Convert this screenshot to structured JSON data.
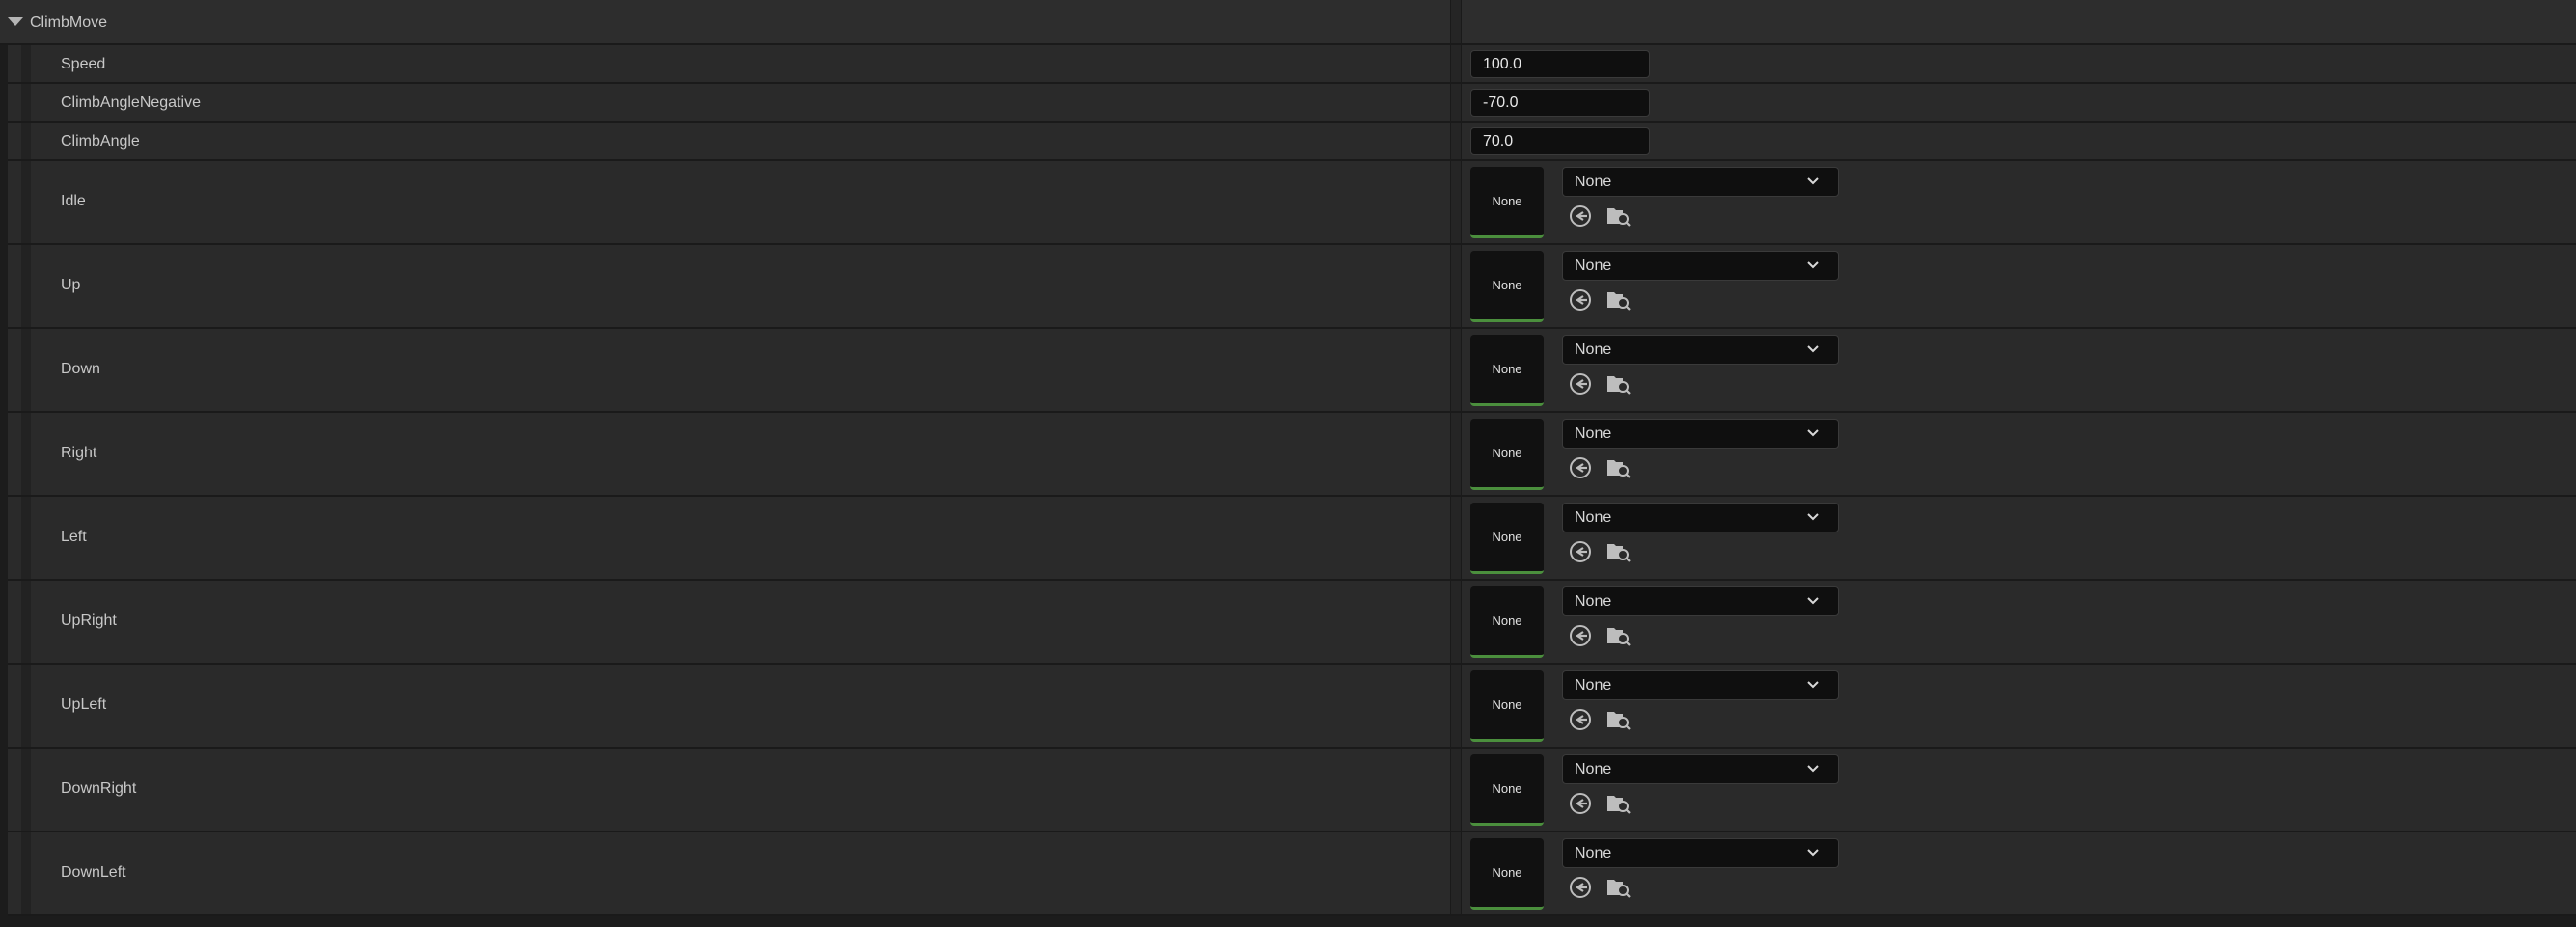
{
  "section": {
    "title": "ClimbMove",
    "icon": "caret-down-icon"
  },
  "numeric_properties": [
    {
      "label": "Speed",
      "value": "100.0"
    },
    {
      "label": "ClimbAngleNegative",
      "value": "-70.0"
    },
    {
      "label": "ClimbAngle",
      "value": "70.0"
    }
  ],
  "asset_properties": [
    {
      "label": "Idle",
      "thumb": "None",
      "selected": "None"
    },
    {
      "label": "Up",
      "thumb": "None",
      "selected": "None"
    },
    {
      "label": "Down",
      "thumb": "None",
      "selected": "None"
    },
    {
      "label": "Right",
      "thumb": "None",
      "selected": "None"
    },
    {
      "label": "Left",
      "thumb": "None",
      "selected": "None"
    },
    {
      "label": "UpRight",
      "thumb": "None",
      "selected": "None"
    },
    {
      "label": "UpLeft",
      "thumb": "None",
      "selected": "None"
    },
    {
      "label": "DownRight",
      "thumb": "None",
      "selected": "None"
    },
    {
      "label": "DownLeft",
      "thumb": "None",
      "selected": "None"
    }
  ],
  "icons": {
    "dropdown": "chevron-down-icon",
    "use_selected": "use-selected-asset-icon",
    "browse": "browse-folder-icon"
  },
  "colors": {
    "background": "#2a2a2a",
    "input": "#0f0f0f",
    "thumb_accent": "#4b8f3d",
    "text": "#c8c8c8"
  }
}
